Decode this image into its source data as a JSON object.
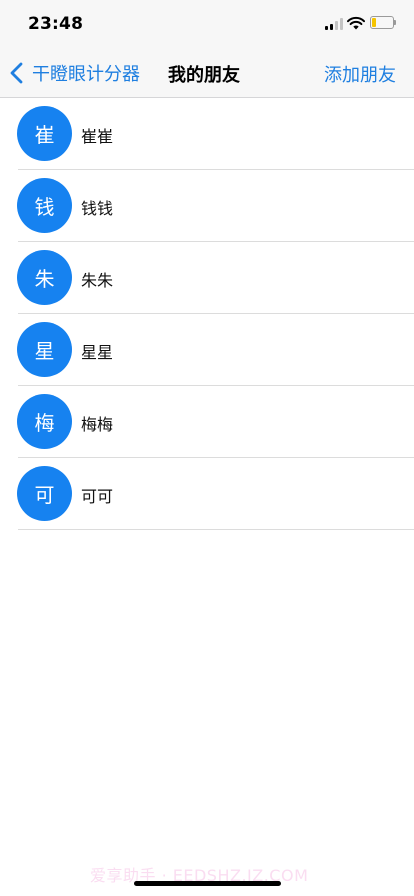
{
  "status_bar": {
    "time": "23:48",
    "battery_color": "#f5c400"
  },
  "nav": {
    "back_label": "干瞪眼计分器",
    "title": "我的朋友",
    "action_label": "添加朋友",
    "accent_color": "#1f7fe0"
  },
  "friends": [
    {
      "avatar": "崔",
      "name": "崔崔"
    },
    {
      "avatar": "钱",
      "name": "钱钱"
    },
    {
      "avatar": "朱",
      "name": "朱朱"
    },
    {
      "avatar": "星",
      "name": "星星"
    },
    {
      "avatar": "梅",
      "name": "梅梅"
    },
    {
      "avatar": "可",
      "name": "可可"
    }
  ],
  "avatar_color": "#1682f0",
  "watermark": "爱享助手 · EEDSHZ.IZ.COM"
}
